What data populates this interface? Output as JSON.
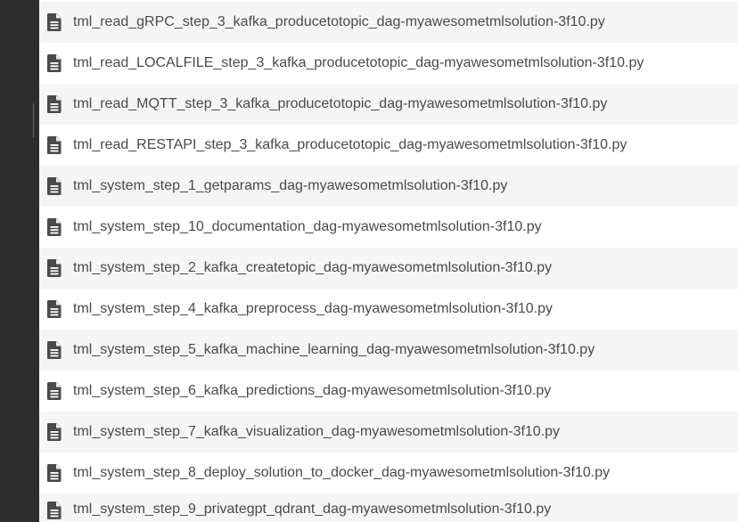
{
  "file_list": {
    "icon": "document-icon",
    "colors": {
      "text": "#4a4a4a",
      "icon": "#4a4a4a",
      "row_alt": "#f5f5f5",
      "row": "#ffffff",
      "gutter": "#2d2d2d"
    },
    "items": [
      {
        "label": "tml_read_gRPC_step_3_kafka_producetotopic_dag-myawesometmlsolution-3f10.py"
      },
      {
        "label": "tml_read_LOCALFILE_step_3_kafka_producetotopic_dag-myawesometmlsolution-3f10.py"
      },
      {
        "label": "tml_read_MQTT_step_3_kafka_producetotopic_dag-myawesometmlsolution-3f10.py"
      },
      {
        "label": "tml_read_RESTAPI_step_3_kafka_producetotopic_dag-myawesometmlsolution-3f10.py"
      },
      {
        "label": "tml_system_step_1_getparams_dag-myawesometmlsolution-3f10.py"
      },
      {
        "label": "tml_system_step_10_documentation_dag-myawesometmlsolution-3f10.py"
      },
      {
        "label": "tml_system_step_2_kafka_createtopic_dag-myawesometmlsolution-3f10.py"
      },
      {
        "label": "tml_system_step_4_kafka_preprocess_dag-myawesometmlsolution-3f10.py"
      },
      {
        "label": "tml_system_step_5_kafka_machine_learning_dag-myawesometmlsolution-3f10.py"
      },
      {
        "label": "tml_system_step_6_kafka_predictions_dag-myawesometmlsolution-3f10.py"
      },
      {
        "label": "tml_system_step_7_kafka_visualization_dag-myawesometmlsolution-3f10.py"
      },
      {
        "label": "tml_system_step_8_deploy_solution_to_docker_dag-myawesometmlsolution-3f10.py"
      },
      {
        "label": "tml_system_step_9_privategpt_qdrant_dag-myawesometmlsolution-3f10.py"
      }
    ]
  }
}
